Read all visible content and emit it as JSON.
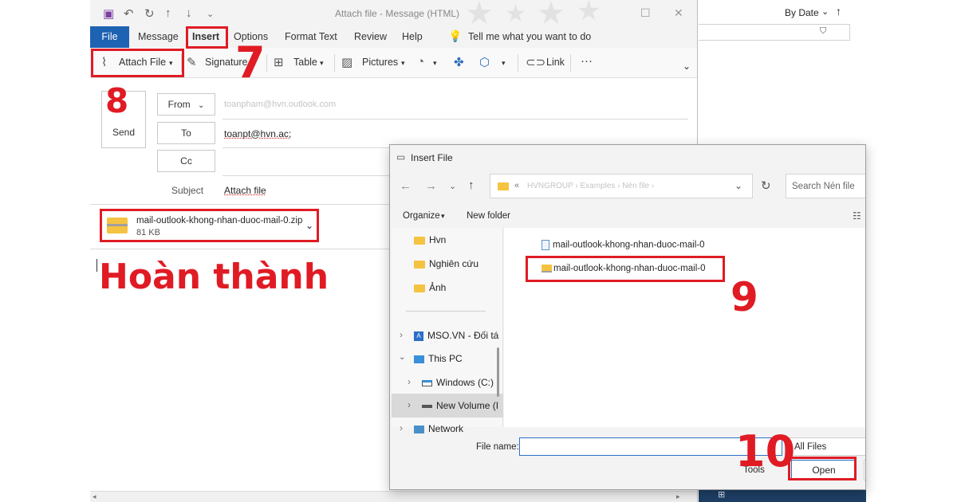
{
  "compose": {
    "window_title": "Attach file  -  Message (HTML)",
    "menu": [
      "File",
      "Message",
      "Insert",
      "Options",
      "Format Text",
      "Review",
      "Help"
    ],
    "tell_me": "Tell me what you want to do",
    "ribbon": {
      "attach_file": "Attach File",
      "signature": "Signature",
      "table": "Table",
      "pictures": "Pictures",
      "link": "Link",
      "more": "···"
    },
    "send_label": "Send",
    "from_label": "From",
    "from_value": "toanpham@hvn.outlook.com",
    "to_label": "To",
    "to_value": "toanpt@hvn.ac;",
    "cc_label": "Cc",
    "subject_label": "Subject",
    "subject_value": "Attach file",
    "attachment": {
      "name": "mail-outlook-khong-nhan-duoc-mail-0.zip",
      "size": "81 KB"
    },
    "done_caption": "Hoàn thành"
  },
  "main_window": {
    "sort_label": "By Date"
  },
  "dialog": {
    "title": "Insert File",
    "address": {
      "prefix": "«",
      "crumbs": [
        "HVNGROUP",
        "Examples",
        "Nén file"
      ]
    },
    "search_placeholder": "Search Nén file",
    "organize": "Organize",
    "new_folder": "New folder",
    "nav": {
      "quick_folders": [
        "Hvn",
        "Nghiên cứu",
        "Ảnh"
      ],
      "mso": "MSO.VN - Đối tá",
      "this_pc": "This PC",
      "windows_c": "Windows (C:)",
      "new_volume": "New Volume (I",
      "network": "Network"
    },
    "files": [
      {
        "name": "mail-outlook-khong-nhan-duoc-mail-0",
        "kind": "document"
      },
      {
        "name": "mail-outlook-khong-nhan-duoc-mail-0",
        "kind": "zip-folder"
      }
    ],
    "file_name_label": "File name:",
    "file_name_value": "",
    "filter_value": "All Files",
    "tools_label": "Tools",
    "open_label": "Open"
  },
  "steps": [
    "7",
    "8",
    "9",
    "10"
  ],
  "colors": {
    "highlight": "#e01b24",
    "outlook_blue": "#1e62b3",
    "folder_yellow": "#f5c342"
  }
}
